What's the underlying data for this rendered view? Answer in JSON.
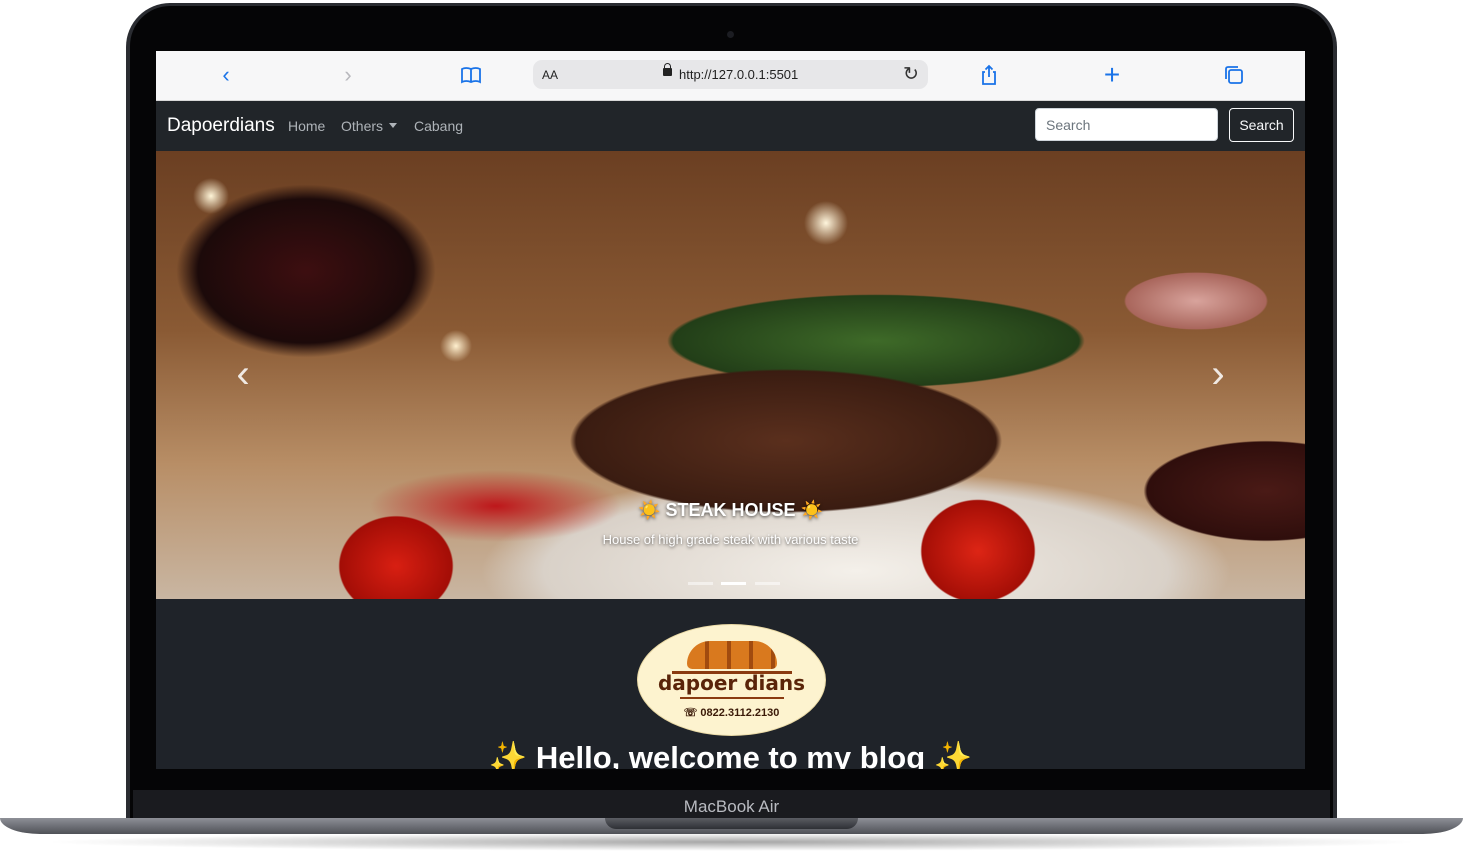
{
  "device": {
    "label": "MacBook Air"
  },
  "browser": {
    "reader_label": "AA",
    "url": "http://127.0.0.1:5501",
    "icons": [
      "back-icon",
      "forward-icon",
      "bookmarks-icon",
      "lock-icon",
      "reload-icon",
      "share-icon",
      "new-tab-icon",
      "tabs-icon"
    ]
  },
  "navbar": {
    "brand": "Dapoerdians",
    "links": [
      "Home",
      "Others",
      "Cabang"
    ],
    "search_placeholder": "Search",
    "search_button": "Search"
  },
  "carousel": {
    "caption_title": "☀️ STEAK HOUSE ☀️",
    "caption_text": "House of high grade steak with various taste",
    "indicator_count": 3,
    "active_indicator": 1
  },
  "logo": {
    "name": "dapoer dians",
    "phone": "☏ 0822.3112.2130"
  },
  "main": {
    "welcome": "✨ Hello, welcome to my blog ✨"
  },
  "colors": {
    "navbar_bg": "#212529",
    "page_bg": "#1f2329",
    "browser_accent": "#1a73e8"
  }
}
